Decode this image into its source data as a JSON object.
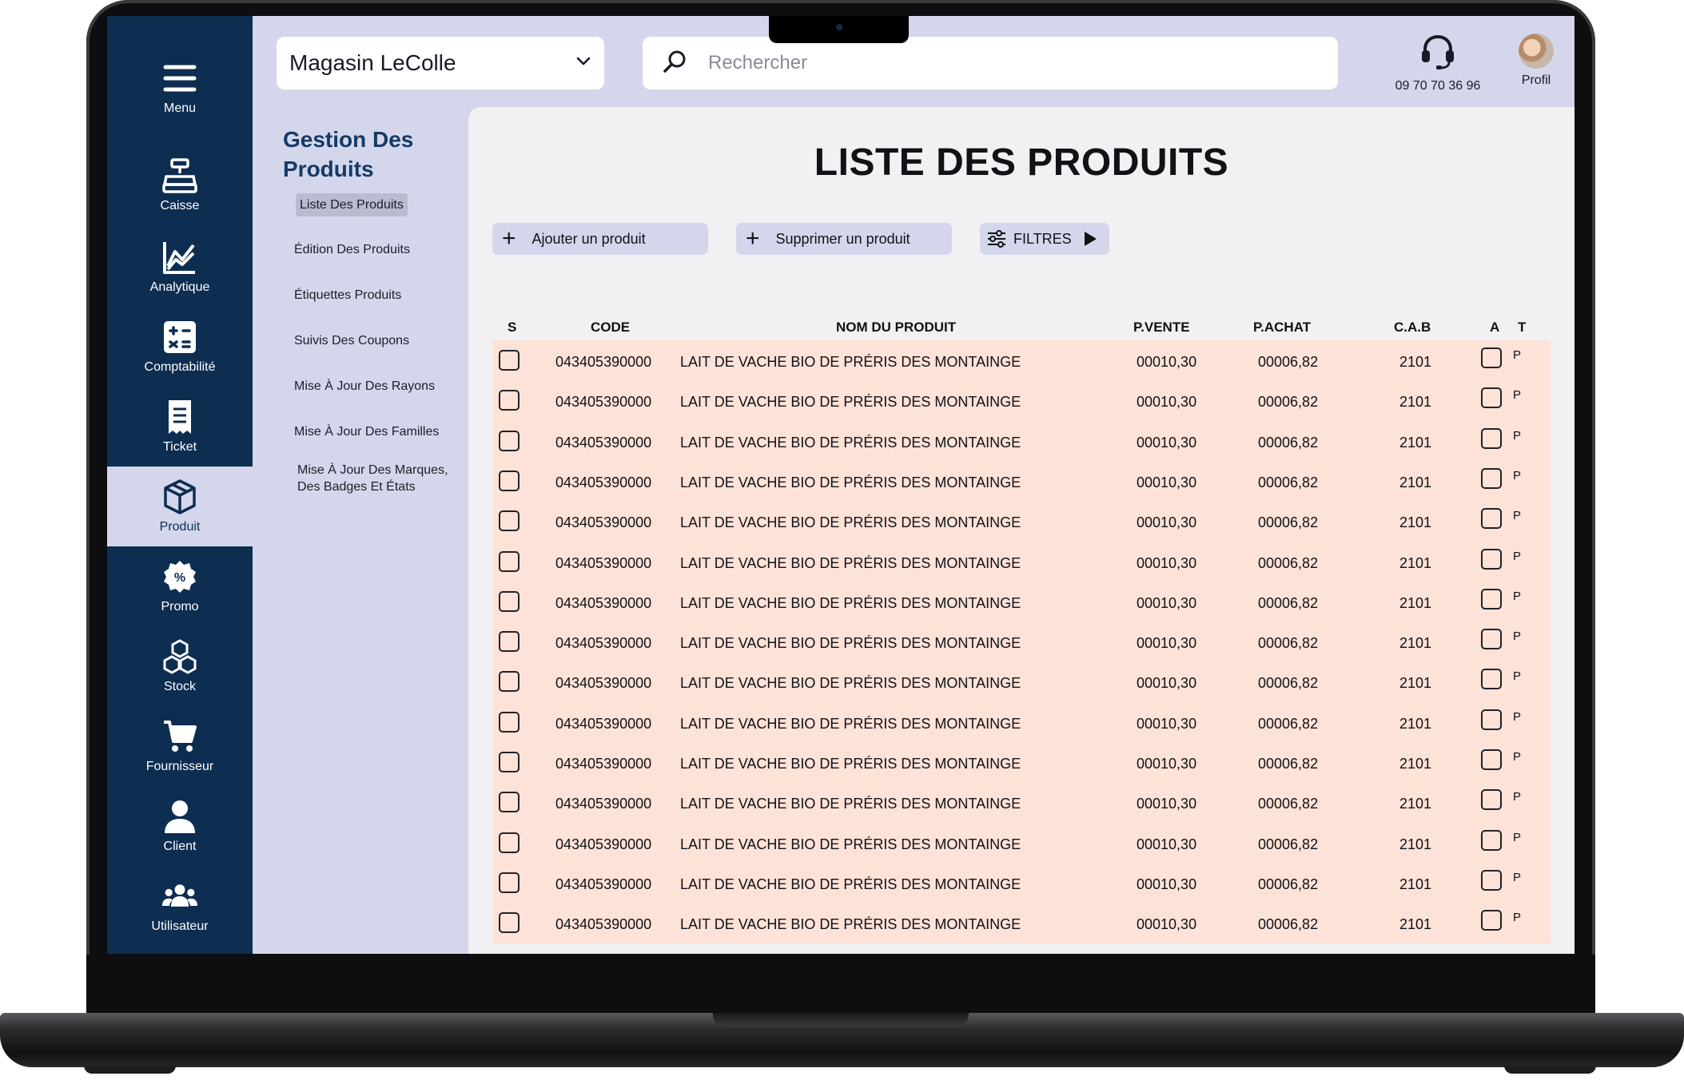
{
  "store_select": {
    "value": "Magasin LeColle"
  },
  "search": {
    "placeholder": "Rechercher"
  },
  "support": {
    "phone": "09 70 70 36 96"
  },
  "profile": {
    "label": "Profil"
  },
  "nav": [
    {
      "label": "Menu",
      "icon": "hamburger-icon"
    },
    {
      "label": "Caisse",
      "icon": "cash-register-icon"
    },
    {
      "label": "Analytique",
      "icon": "analytics-chart-icon"
    },
    {
      "label": "Comptabilité",
      "icon": "calculator-icon"
    },
    {
      "label": "Ticket",
      "icon": "receipt-icon"
    },
    {
      "label": "Produit",
      "icon": "box-icon"
    },
    {
      "label": "Promo",
      "icon": "promo-badge-icon"
    },
    {
      "label": "Stock",
      "icon": "stacked-boxes-icon"
    },
    {
      "label": "Fournisseur",
      "icon": "cart-icon"
    },
    {
      "label": "Client",
      "icon": "user-icon"
    },
    {
      "label": "Utilisateur",
      "icon": "users-group-icon"
    }
  ],
  "submenu": {
    "title": "Gestion Des Produits",
    "items": [
      "Liste Des Produits",
      "Édition Des Produits",
      "Étiquettes Produits",
      "Suivis Des Coupons",
      "Mise À Jour Des Rayons",
      "Mise À Jour Des Familles",
      "Mise À Jour Des Marques, Des Badges Et États"
    ]
  },
  "main": {
    "title": "LISTE DES PRODUITS",
    "buttons": {
      "add": "Ajouter un produit",
      "delete": "Supprimer un produit",
      "filters": "FILTRES"
    }
  },
  "table": {
    "columns": [
      "S",
      "CODE",
      "NOM DU PRODUIT",
      "P.VENTE",
      "P.ACHAT",
      "C.A.B",
      "A",
      "T"
    ],
    "rows": [
      {
        "code": "043405390000",
        "name": "LAIT DE VACHE BIO DE PRÉRIS DES MONTAINGE",
        "pvente": "00010,30",
        "pachat": "00006,82",
        "cab": "2101",
        "t": "P"
      },
      {
        "code": "043405390000",
        "name": "LAIT DE VACHE BIO DE PRÉRIS DES MONTAINGE",
        "pvente": "00010,30",
        "pachat": "00006,82",
        "cab": "2101",
        "t": "P"
      },
      {
        "code": "043405390000",
        "name": "LAIT DE VACHE BIO DE PRÉRIS DES MONTAINGE",
        "pvente": "00010,30",
        "pachat": "00006,82",
        "cab": "2101",
        "t": "P"
      },
      {
        "code": "043405390000",
        "name": "LAIT DE VACHE BIO DE PRÉRIS DES MONTAINGE",
        "pvente": "00010,30",
        "pachat": "00006,82",
        "cab": "2101",
        "t": "P"
      },
      {
        "code": "043405390000",
        "name": "LAIT DE VACHE BIO DE PRÉRIS DES MONTAINGE",
        "pvente": "00010,30",
        "pachat": "00006,82",
        "cab": "2101",
        "t": "P"
      },
      {
        "code": "043405390000",
        "name": "LAIT DE VACHE BIO DE PRÉRIS DES MONTAINGE",
        "pvente": "00010,30",
        "pachat": "00006,82",
        "cab": "2101",
        "t": "P"
      },
      {
        "code": "043405390000",
        "name": "LAIT DE VACHE BIO DE PRÉRIS DES MONTAINGE",
        "pvente": "00010,30",
        "pachat": "00006,82",
        "cab": "2101",
        "t": "P"
      },
      {
        "code": "043405390000",
        "name": "LAIT DE VACHE BIO DE PRÉRIS DES MONTAINGE",
        "pvente": "00010,30",
        "pachat": "00006,82",
        "cab": "2101",
        "t": "P"
      },
      {
        "code": "043405390000",
        "name": "LAIT DE VACHE BIO DE PRÉRIS DES MONTAINGE",
        "pvente": "00010,30",
        "pachat": "00006,82",
        "cab": "2101",
        "t": "P"
      },
      {
        "code": "043405390000",
        "name": "LAIT DE VACHE BIO DE PRÉRIS DES MONTAINGE",
        "pvente": "00010,30",
        "pachat": "00006,82",
        "cab": "2101",
        "t": "P"
      },
      {
        "code": "043405390000",
        "name": "LAIT DE VACHE BIO DE PRÉRIS DES MONTAINGE",
        "pvente": "00010,30",
        "pachat": "00006,82",
        "cab": "2101",
        "t": "P"
      },
      {
        "code": "043405390000",
        "name": "LAIT DE VACHE BIO DE PRÉRIS DES MONTAINGE",
        "pvente": "00010,30",
        "pachat": "00006,82",
        "cab": "2101",
        "t": "P"
      },
      {
        "code": "043405390000",
        "name": "LAIT DE VACHE BIO DE PRÉRIS DES MONTAINGE",
        "pvente": "00010,30",
        "pachat": "00006,82",
        "cab": "2101",
        "t": "P"
      },
      {
        "code": "043405390000",
        "name": "LAIT DE VACHE BIO DE PRÉRIS DES MONTAINGE",
        "pvente": "00010,30",
        "pachat": "00006,82",
        "cab": "2101",
        "t": "P"
      },
      {
        "code": "043405390000",
        "name": "LAIT DE VACHE BIO DE PRÉRIS DES MONTAINGE",
        "pvente": "00010,30",
        "pachat": "00006,82",
        "cab": "2101",
        "t": "P"
      }
    ]
  },
  "colors": {
    "nav_bg": "#0d2d51",
    "app_bg": "#d4d7ec",
    "panel_bg": "#f1f1f4",
    "row_bg": "#fde2d8",
    "title_blue": "#163a66"
  }
}
